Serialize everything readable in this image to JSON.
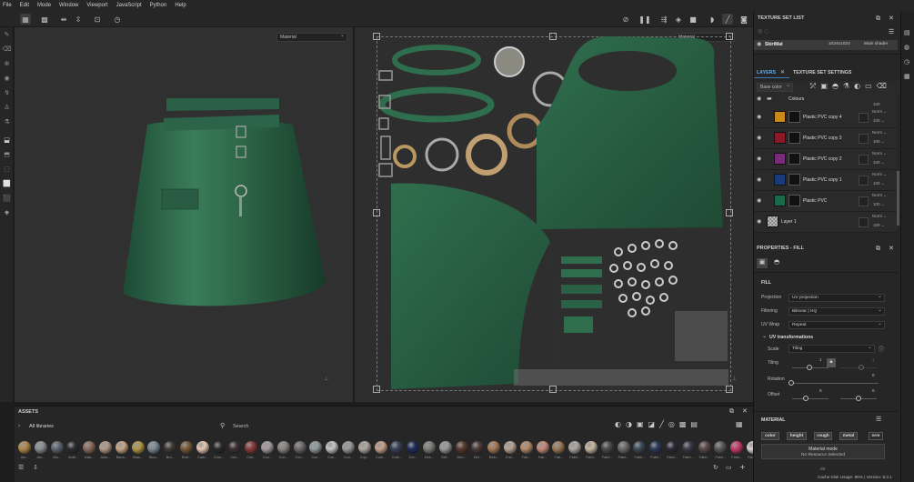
{
  "menu": [
    "File",
    "Edit",
    "Mode",
    "Window",
    "Viewport",
    "JavaScript",
    "Python",
    "Help"
  ],
  "viewport": {
    "material_3d": "Material",
    "material_2d": "Material"
  },
  "assets": {
    "title": "ASSETS",
    "breadcrumb": "All libraries",
    "search_placeholder": "Search",
    "materials": [
      {
        "label": "Alu...",
        "color": "#b3874a"
      },
      {
        "label": "Alu...",
        "color": "#8a8f96"
      },
      {
        "label": "Alu...",
        "color": "#5c6670"
      },
      {
        "label": "Antil...",
        "color": "#2b2d33"
      },
      {
        "label": "Asia...",
        "color": "#8d6a5a"
      },
      {
        "label": "Autu...",
        "color": "#b49a8a"
      },
      {
        "label": "Bana...",
        "color": "#c8a888"
      },
      {
        "label": "Bras...",
        "color": "#b39848"
      },
      {
        "label": "Bloo...",
        "color": "#7a8a95"
      },
      {
        "label": "Bro...",
        "color": "#3e3a35"
      },
      {
        "label": "Butt...",
        "color": "#7a5a3a"
      },
      {
        "label": "Carb...",
        "color": "#e8c7b0"
      },
      {
        "label": "Chro...",
        "color": "#2a2a2a"
      },
      {
        "label": "Circ...",
        "color": "#3b3230"
      },
      {
        "label": "Clot...",
        "color": "#8b3b3a"
      },
      {
        "label": "Con...",
        "color": "#a59aa0"
      },
      {
        "label": "Con...",
        "color": "#8a8580"
      },
      {
        "label": "Con...",
        "color": "#6d6a68"
      },
      {
        "label": "Con...",
        "color": "#909a9a"
      },
      {
        "label": "Con...",
        "color": "#c4c4c4"
      },
      {
        "label": "Con...",
        "color": "#9a9a9a"
      },
      {
        "label": "Cop...",
        "color": "#b0a8a2"
      },
      {
        "label": "Cork...",
        "color": "#c8a48a"
      },
      {
        "label": "Cote...",
        "color": "#3a4358"
      },
      {
        "label": "Cre...",
        "color": "#1f2c5a"
      },
      {
        "label": "Dee...",
        "color": "#7d7d7a"
      },
      {
        "label": "Def...",
        "color": "#9a9a9a"
      },
      {
        "label": "Den...",
        "color": "#5a3a2c"
      },
      {
        "label": "Dirt...",
        "color": "#4a3b38"
      },
      {
        "label": "Emb...",
        "color": "#a67a55"
      },
      {
        "label": "Enb...",
        "color": "#b9a494"
      },
      {
        "label": "Fab...",
        "color": "#b48a6a"
      },
      {
        "label": "Fab...",
        "color": "#c88a7a"
      },
      {
        "label": "Fab...",
        "color": "#9a7a5a"
      },
      {
        "label": "Fabri...",
        "color": "#b0a8a0"
      },
      {
        "label": "Fabri...",
        "color": "#c8b8a0"
      },
      {
        "label": "Fabri...",
        "color": "#4a4a4a"
      },
      {
        "label": "Fabri...",
        "color": "#6a6a6a"
      },
      {
        "label": "Fabri...",
        "color": "#3a4a5a"
      },
      {
        "label": "Fabri...",
        "color": "#2a3a5a"
      },
      {
        "label": "Fabri...",
        "color": "#2a2a3a"
      },
      {
        "label": "Fabri...",
        "color": "#3a3a4a"
      },
      {
        "label": "Fabri...",
        "color": "#5a4a4a"
      },
      {
        "label": "Fabri...",
        "color": "#5a5a5a"
      },
      {
        "label": "Fabri...",
        "color": "#c83a6a"
      },
      {
        "label": "Fabri...",
        "color": "#d4d4d4"
      }
    ]
  },
  "texture_set_list": {
    "title": "TEXTURE SET LIST",
    "name": "SkirtMat",
    "size": "1024x1024",
    "shader": "Main shader"
  },
  "layers": {
    "tab_layers": "LAYERS",
    "tab_settings": "TEXTURE SET SETTINGS",
    "channel": "Base color",
    "folder": "Colours",
    "folder_opacity": "100",
    "rows": [
      {
        "name": "Plastic PVC copy 4",
        "color": "#c98a1a",
        "blend": "Norm",
        "opacity": "100"
      },
      {
        "name": "Plastic PVC copy 3",
        "color": "#8a1a2a",
        "blend": "Norm",
        "opacity": "100"
      },
      {
        "name": "Plastic PVC copy 2",
        "color": "#7a2a7a",
        "blend": "Norm",
        "opacity": "100"
      },
      {
        "name": "Plastic PVC copy 1",
        "color": "#1a3a7a",
        "blend": "Norm",
        "opacity": "100"
      },
      {
        "name": "Plastic PVC",
        "color": "#1a6a4a",
        "blend": "Norm",
        "opacity": "100"
      },
      {
        "name": "Layer 1",
        "color": "#cccccc",
        "blend": "Norm",
        "opacity": "100"
      }
    ]
  },
  "properties": {
    "title": "PROPERTIES - FILL",
    "fill_header": "FILL",
    "projection_label": "Projection",
    "projection_value": "UV projection",
    "filtering_label": "Filtering",
    "filtering_value": "Bilinear | HQ",
    "uvwrap_label": "UV Wrap",
    "uvwrap_value": "Repeat",
    "uvtrans_header": "UV transformations",
    "scale_label": "Scale",
    "scale_value": "Tiling",
    "tiling_label": "Tiling",
    "tiling_value": "1",
    "tiling_value2": "1",
    "rotation_label": "Rotation",
    "rotation_value": "0",
    "offset_label": "Offset",
    "offset_x": "0",
    "offset_y": "0",
    "material_header": "MATERIAL",
    "channels": [
      "color",
      "height",
      "rough",
      "metal",
      "nrm"
    ],
    "material_mode": "Material mode",
    "no_resource": "No Resource Selected",
    "or": "Or"
  },
  "status": {
    "cache": "Cache Disk Usage:",
    "cache_pct": "85%",
    "version": "| Version: 8.3.1"
  },
  "colors": {
    "skirt": "#2f6a4a",
    "skirt_dark": "#1f4a34",
    "accent": "#3a7ab8"
  }
}
